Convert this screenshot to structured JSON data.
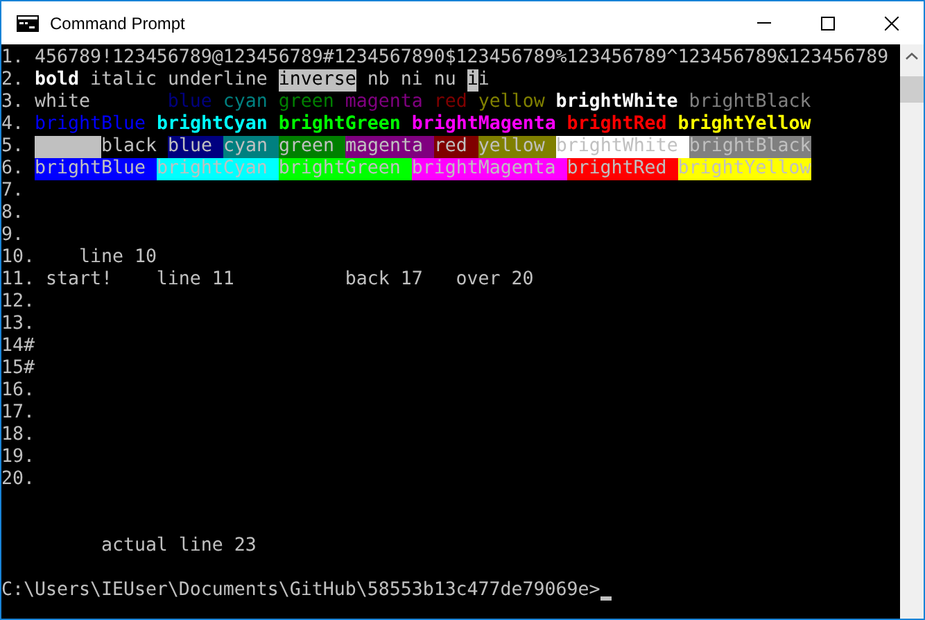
{
  "window": {
    "title": "Command Prompt"
  },
  "terminal": {
    "lines": [
      {
        "segments": [
          {
            "text": "1. 456789!123456789@123456789#1234567890$123456789%123456789^123456789&123456789"
          }
        ]
      },
      {
        "segments": [
          {
            "text": "2. "
          },
          {
            "text": "bold",
            "bold": true,
            "color": "#ffffff"
          },
          {
            "text": " italic underline "
          },
          {
            "text": "inverse",
            "color": "#000000",
            "background": {
              "color": "#c0c0c0"
            }
          },
          {
            "text": " nb ni nu "
          },
          {
            "text": "i",
            "color": "#000000",
            "background": {
              "color": "#c0c0c0"
            }
          },
          {
            "text": "i"
          }
        ]
      },
      {
        "segments": [
          {
            "text": "3. white"
          },
          {
            "text": "       blue",
            "color": "#000080"
          },
          {
            "text": " cyan",
            "color": "#008080"
          },
          {
            "text": " green",
            "color": "#008000"
          },
          {
            "text": " magenta",
            "color": "#800080"
          },
          {
            "text": " red",
            "color": "#800000"
          },
          {
            "text": " yellow",
            "color": "#808000"
          },
          {
            "text": " brightWhite",
            "color": "#ffffff",
            "bold": true
          },
          {
            "text": " brightBlack",
            "color": "#808080"
          }
        ]
      },
      {
        "segments": [
          {
            "text": "4. "
          },
          {
            "text": "brightBlue",
            "color": "#0000ff"
          },
          {
            "text": " brightCyan",
            "color": "#00ffff",
            "bold": true
          },
          {
            "text": " brightGreen",
            "color": "#00ff00",
            "bold": true
          },
          {
            "text": " brightMagenta",
            "color": "#ff00ff",
            "bold": true
          },
          {
            "text": " brightRed",
            "color": "#ff0000",
            "bold": true
          },
          {
            "text": " brightYellow",
            "color": "#ffff00",
            "bold": true
          }
        ]
      },
      {
        "segments": [
          {
            "text": "5. "
          },
          {
            "kind": "block",
            "background": {
              "color": "#c0c0c0"
            }
          },
          {
            "text": "black "
          },
          {
            "text": "blue ",
            "background": {
              "color": "#000080"
            }
          },
          {
            "text": "cyan ",
            "background": {
              "color": "#008080"
            }
          },
          {
            "text": "green ",
            "background": {
              "color": "#008000"
            }
          },
          {
            "text": "magenta ",
            "background": {
              "color": "#800080"
            }
          },
          {
            "text": "red ",
            "background": {
              "color": "#800000"
            }
          },
          {
            "text": "yellow ",
            "background": {
              "color": "#808000"
            }
          },
          {
            "text": "brightWhite ",
            "background": {
              "color": "#ffffff"
            }
          },
          {
            "text": "brightBlack",
            "background": {
              "color": "#808080"
            }
          }
        ]
      },
      {
        "segments": [
          {
            "text": "6. "
          },
          {
            "text": "brightBlue ",
            "background": {
              "color": "#0000ff"
            }
          },
          {
            "text": "brightCyan ",
            "background": {
              "color": "#00ffff"
            }
          },
          {
            "text": "brightGreen ",
            "background": {
              "color": "#00ff00"
            }
          },
          {
            "text": "brightMagenta ",
            "background": {
              "color": "#ff00ff"
            }
          },
          {
            "text": "brightRed ",
            "background": {
              "color": "#ff0000"
            }
          },
          {
            "text": "brightYellow",
            "background": {
              "color": "#ffff00"
            }
          }
        ]
      },
      {
        "segments": [
          {
            "text": "7."
          }
        ]
      },
      {
        "segments": [
          {
            "text": "8."
          }
        ]
      },
      {
        "segments": [
          {
            "text": "9."
          }
        ]
      },
      {
        "segments": [
          {
            "text": "10.    line 10"
          }
        ]
      },
      {
        "segments": [
          {
            "text": "11. start!    line 11          back 17   over 20"
          }
        ]
      },
      {
        "segments": [
          {
            "text": "12."
          }
        ]
      },
      {
        "segments": [
          {
            "text": "13."
          }
        ]
      },
      {
        "segments": [
          {
            "text": "14#"
          }
        ]
      },
      {
        "segments": [
          {
            "text": "15#"
          }
        ]
      },
      {
        "segments": [
          {
            "text": "16."
          }
        ]
      },
      {
        "segments": [
          {
            "text": "17."
          }
        ]
      },
      {
        "segments": [
          {
            "text": "18."
          }
        ]
      },
      {
        "segments": [
          {
            "text": "19."
          }
        ]
      },
      {
        "segments": [
          {
            "text": "20."
          }
        ]
      }
    ],
    "late_line": "         actual line 23",
    "prompt": {
      "text": "C:\\Users\\IEUser\\Documents\\GitHub\\58553b13c477de79069e>",
      "cursor_visible": true
    }
  }
}
